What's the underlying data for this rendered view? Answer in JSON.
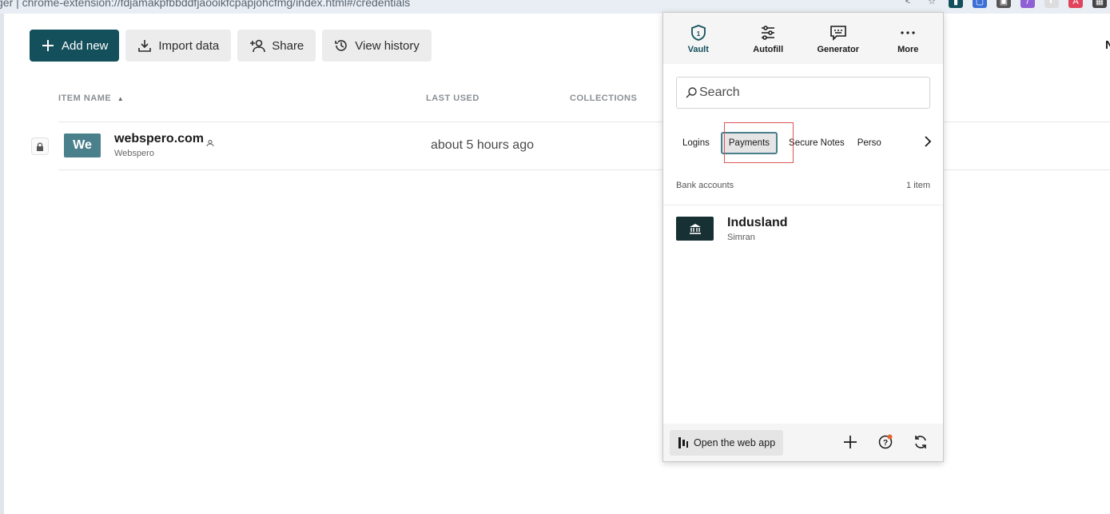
{
  "browser": {
    "url_text": "ger  |  chrome-extension://fdjamakpfbbddfjaooikfcpapjohcfmg/index.html#/credentials"
  },
  "toolbar": {
    "add_new": "Add new",
    "import_data": "Import data",
    "share": "Share",
    "view_history": "View history"
  },
  "table": {
    "headers": {
      "item_name": "ITEM NAME",
      "last_used": "LAST USED",
      "collections": "COLLECTIONS"
    },
    "rows": [
      {
        "avatar": "We",
        "title": "webspero.com",
        "subtitle": "Webspero",
        "last_used": "about 5 hours ago"
      }
    ]
  },
  "right_edge_letter": "N",
  "popup": {
    "nav": [
      {
        "label": "Vault",
        "icon": "shield-icon"
      },
      {
        "label": "Autofill",
        "icon": "sliders-icon"
      },
      {
        "label": "Generator",
        "icon": "generator-icon"
      },
      {
        "label": "More",
        "icon": "more-icon"
      }
    ],
    "search_placeholder": "Search",
    "categories": [
      "Logins",
      "Payments",
      "Secure Notes",
      "Perso"
    ],
    "section": {
      "title": "Bank accounts",
      "count": "1 item"
    },
    "items": [
      {
        "title": "Indusland",
        "subtitle": "Simran",
        "icon": "bank-icon"
      }
    ],
    "footer": {
      "open_web_app": "Open the web app"
    }
  },
  "colors": {
    "primary": "#14505c",
    "avatar": "#4a7f8c",
    "bank_icon_bg": "#173033",
    "highlight": "#e05555",
    "notification_dot": "#e8622d"
  }
}
